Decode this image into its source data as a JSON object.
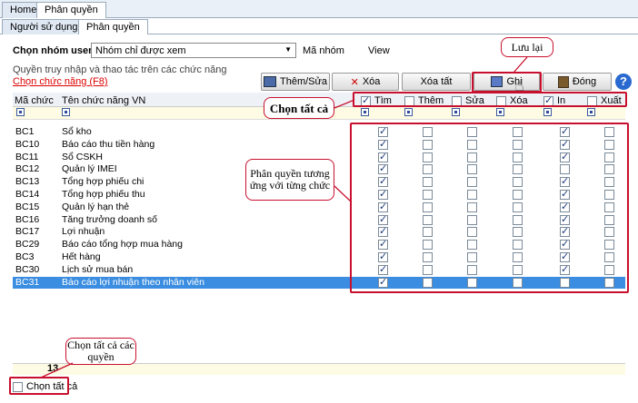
{
  "tabs_top": [
    "Home",
    "Phân quyền"
  ],
  "tabs_sub": [
    "Người sử dụng",
    "Phân quyền"
  ],
  "group": {
    "label": "Chọn nhóm user",
    "value": "Nhóm chỉ được xem",
    "code_label": "Mã nhóm",
    "code_value": "View"
  },
  "section_title": "Quyền truy nhập và thao tác trên các chức năng",
  "select_function_link": "Chọn chức năng (F8)",
  "buttons": {
    "add_edit": "Thêm/Sửa",
    "delete": "Xóa",
    "delete_all": "Xóa tất",
    "save": "Ghi",
    "close": "Đóng"
  },
  "columns": {
    "code": "Mã chức",
    "name": "Tên chức năng VN"
  },
  "perm_columns": [
    {
      "label": "Tìm",
      "checked": true
    },
    {
      "label": "Thêm",
      "checked": false
    },
    {
      "label": "Sửa",
      "checked": false
    },
    {
      "label": "Xóa",
      "checked": false
    },
    {
      "label": "In",
      "checked": true
    },
    {
      "label": "Xuất",
      "checked": false
    }
  ],
  "rows": [
    {
      "code": "BC1",
      "name": "Sổ kho",
      "perms": [
        1,
        0,
        0,
        0,
        1,
        0
      ]
    },
    {
      "code": "BC10",
      "name": "Báo cáo thu tiền hàng",
      "perms": [
        1,
        0,
        0,
        0,
        1,
        0
      ]
    },
    {
      "code": "BC11",
      "name": "Sổ CSKH",
      "perms": [
        1,
        0,
        0,
        0,
        1,
        0
      ]
    },
    {
      "code": "BC12",
      "name": "Quản lý IMEI",
      "perms": [
        1,
        0,
        0,
        0,
        0,
        0
      ]
    },
    {
      "code": "BC13",
      "name": "Tổng hợp phiếu chi",
      "perms": [
        1,
        0,
        0,
        0,
        1,
        0
      ]
    },
    {
      "code": "BC14",
      "name": "Tổng hợp phiếu thu",
      "perms": [
        1,
        0,
        0,
        0,
        1,
        0
      ]
    },
    {
      "code": "BC15",
      "name": "Quản lý hạn thẻ",
      "perms": [
        1,
        0,
        0,
        0,
        1,
        0
      ]
    },
    {
      "code": "BC16",
      "name": "Tăng trưởng doanh số",
      "perms": [
        1,
        0,
        0,
        0,
        1,
        0
      ]
    },
    {
      "code": "BC17",
      "name": "Lợi nhuận",
      "perms": [
        1,
        0,
        0,
        0,
        1,
        0
      ]
    },
    {
      "code": "BC29",
      "name": "Báo cáo tổng hợp mua hàng",
      "perms": [
        1,
        0,
        0,
        0,
        1,
        0
      ]
    },
    {
      "code": "BC3",
      "name": "Hết hàng",
      "perms": [
        1,
        0,
        0,
        0,
        1,
        0
      ]
    },
    {
      "code": "BC30",
      "name": "Lịch sử mua bán",
      "perms": [
        1,
        0,
        0,
        0,
        1,
        0
      ]
    },
    {
      "code": "BC31",
      "name": "Báo cáo lợi nhuận theo nhân viên",
      "perms": [
        1,
        0,
        0,
        0,
        0,
        0
      ]
    }
  ],
  "row_count": "13",
  "select_all_bottom": "Chọn tất cả",
  "callouts": {
    "save": "Lưu lại",
    "select_all": "Chọn tất cả",
    "per_function": "Phân quyền tương ứng với từng chức",
    "select_all_perms": "Chọn tất cả các quyền"
  },
  "colors": {
    "accent_red": "#c8102e",
    "selected_row": "#3a8de0",
    "filter_bg": "#fdfbe3"
  }
}
